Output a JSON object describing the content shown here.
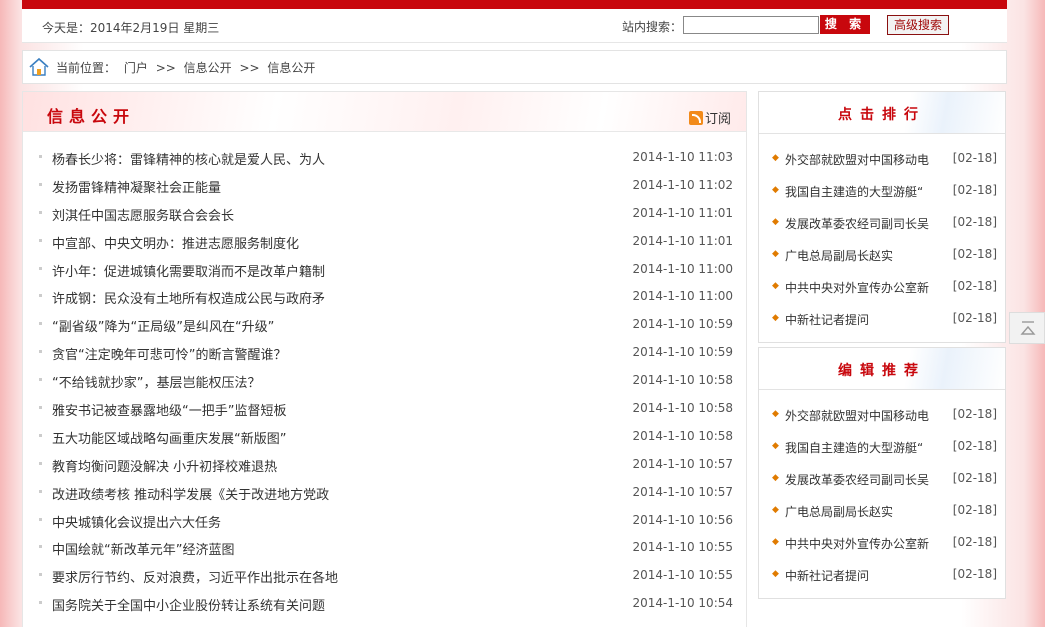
{
  "header": {
    "date": "今天是：2014年2月19日 星期三",
    "search_label": "站内搜索：",
    "search_value": "",
    "search_button": "搜 索",
    "advanced_button": "高级搜索"
  },
  "breadcrumb": {
    "label": "当前位置：",
    "items": [
      "门户",
      ">>",
      "信息公开",
      ">>",
      "信息公开"
    ]
  },
  "main": {
    "title": "信息公开",
    "rss_label": "订阅",
    "items": [
      {
        "title": "杨春长少将：雷锋精神的核心就是爱人民、为人",
        "date": "2014-1-10 11:03"
      },
      {
        "title": "发扬雷锋精神凝聚社会正能量",
        "date": "2014-1-10 11:02"
      },
      {
        "title": "刘淇任中国志愿服务联合会会长",
        "date": "2014-1-10 11:01"
      },
      {
        "title": "中宣部、中央文明办：推进志愿服务制度化",
        "date": "2014-1-10 11:01"
      },
      {
        "title": "许小年：促进城镇化需要取消而不是改革户籍制",
        "date": "2014-1-10 11:00"
      },
      {
        "title": "许成钢：民众没有土地所有权造成公民与政府矛",
        "date": "2014-1-10 11:00"
      },
      {
        "title": "“副省级”降为“正局级”是纠风在“升级”",
        "date": "2014-1-10 10:59"
      },
      {
        "title": "贪官“注定晚年可悲可怜”的断言警醒谁？",
        "date": "2014-1-10 10:59"
      },
      {
        "title": "“不给钱就抄家”，基层岂能权压法？",
        "date": "2014-1-10 10:58"
      },
      {
        "title": "雅安书记被查暴露地级“一把手”监督短板",
        "date": "2014-1-10 10:58"
      },
      {
        "title": "五大功能区域战略勾画重庆发展“新版图”",
        "date": "2014-1-10 10:58"
      },
      {
        "title": "教育均衡问题没解决 小升初择校难退热",
        "date": "2014-1-10 10:57"
      },
      {
        "title": "改进政绩考核 推动科学发展《关于改进地方党政",
        "date": "2014-1-10 10:57"
      },
      {
        "title": "中央城镇化会议提出六大任务",
        "date": "2014-1-10 10:56"
      },
      {
        "title": "中国绘就“新改革元年”经济蓝图",
        "date": "2014-1-10 10:55"
      },
      {
        "title": "要求厉行节约、反对浪费，习近平作出批示在各地",
        "date": "2014-1-10 10:55"
      },
      {
        "title": "国务院关于全国中小企业股份转让系统有关问题",
        "date": "2014-1-10 10:54"
      }
    ]
  },
  "side_hot": {
    "title": "点击排行",
    "items": [
      {
        "title": "外交部就欧盟对中国移动电",
        "date": "[02-18]"
      },
      {
        "title": "我国自主建造的大型游艇“",
        "date": "[02-18]"
      },
      {
        "title": "发展改革委农经司副司长吴",
        "date": "[02-18]"
      },
      {
        "title": "广电总局副局长赵实",
        "date": "[02-18]"
      },
      {
        "title": "中共中央对外宣传办公室新",
        "date": "[02-18]"
      },
      {
        "title": "中新社记者提问",
        "date": "[02-18]"
      }
    ]
  },
  "side_editor": {
    "title": "编辑推荐",
    "items": [
      {
        "title": "外交部就欧盟对中国移动电",
        "date": "[02-18]"
      },
      {
        "title": "我国自主建造的大型游艇“",
        "date": "[02-18]"
      },
      {
        "title": "发展改革委农经司副司长吴",
        "date": "[02-18]"
      },
      {
        "title": "广电总局副局长赵实",
        "date": "[02-18]"
      },
      {
        "title": "中共中央对外宣传办公室新",
        "date": "[02-18]"
      },
      {
        "title": "中新社记者提问",
        "date": "[02-18]"
      }
    ]
  },
  "colors": {
    "brand_red": "#c8070d",
    "bullet_orange": "#e07b00"
  }
}
